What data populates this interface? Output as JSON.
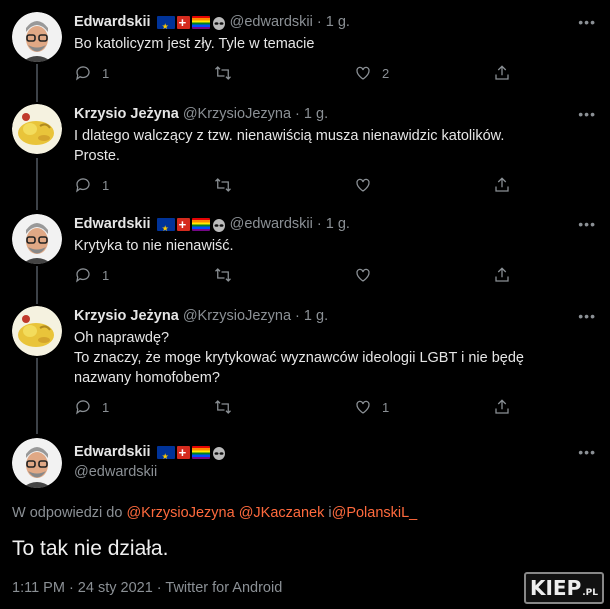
{
  "tweets": [
    {
      "name": "Edwardskii",
      "handle": "@edwardskii",
      "time": "1 g.",
      "text": "Bo katolicyzm jest zły. Tyle w temacie",
      "reply_count": "1",
      "like_count": "2"
    },
    {
      "name": "Krzysio Jeżyna",
      "handle": "@KrzysioJezyna",
      "time": "1 g.",
      "text1": "I dlatego walczący z tzw. nienawiścią musza nienawidzic katolików.",
      "text2": "Proste.",
      "reply_count": "1"
    },
    {
      "name": "Edwardskii",
      "handle": "@edwardskii",
      "time": "1 g.",
      "text": "Krytyka to nie nienawiść.",
      "reply_count": "1"
    },
    {
      "name": "Krzysio Jeżyna",
      "handle": "@KrzysioJezyna",
      "time": "1 g.",
      "text1": "Oh naprawdę?",
      "text2": "To znaczy, że moge krytykować wyznawców ideologii LGBT i nie będę",
      "text3": "nazwany homofobem?",
      "reply_count": "1",
      "like_count": "1"
    }
  ],
  "main": {
    "name": "Edwardskii",
    "handle": "@edwardskii",
    "reply_prefix": "W odpowiedzi do ",
    "mention1": "@KrzysioJezyna",
    "mention2": "@JKaczanek",
    "reply_and": " i",
    "mention3": "@PolanskiL_",
    "text": "To tak nie działa.",
    "meta": "1:11 PM · 24 sty 2021 · Twitter for Android"
  },
  "watermark": {
    "main": "KIEP",
    "suffix": ".PL"
  },
  "icons": [
    "reply-icon",
    "retweet-icon",
    "like-icon",
    "share-icon",
    "more-icon",
    "alien-icon"
  ],
  "colors": {
    "background": "#000000",
    "mention": "#ff6a3d",
    "muted": "#8b9095"
  }
}
